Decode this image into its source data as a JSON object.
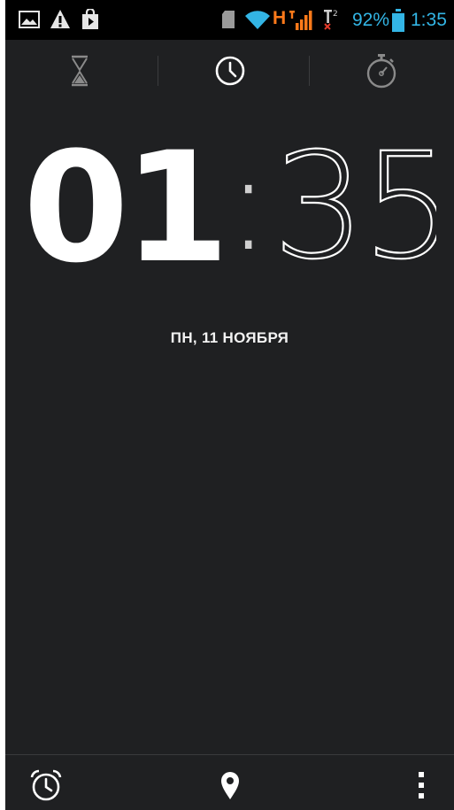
{
  "status_bar": {
    "left_icons": [
      "gallery-icon",
      "warning-icon",
      "play-store-icon"
    ],
    "network_type": "H",
    "battery_percent": "92%",
    "battery_level": 0.92,
    "time": "1:35",
    "accent_color": "#33b5e5",
    "network_color": "#ff7a1a"
  },
  "tabs": [
    {
      "name": "timer",
      "icon": "hourglass-icon",
      "selected": false
    },
    {
      "name": "clock",
      "icon": "clock-icon",
      "selected": true
    },
    {
      "name": "stopwatch",
      "icon": "stopwatch-icon",
      "selected": false
    }
  ],
  "clock": {
    "hours": "01",
    "separator": ":",
    "minutes": "35",
    "date": "ПН, 11 НОЯБРЯ"
  },
  "bottom_bar": {
    "buttons": [
      {
        "name": "alarm",
        "icon": "alarm-clock-icon"
      },
      {
        "name": "cities",
        "icon": "location-pin-icon"
      },
      {
        "name": "menu",
        "icon": "overflow-menu-icon"
      }
    ]
  },
  "colors": {
    "background": "#1f2022",
    "status_bar": "#000000",
    "text": "#ffffff"
  }
}
